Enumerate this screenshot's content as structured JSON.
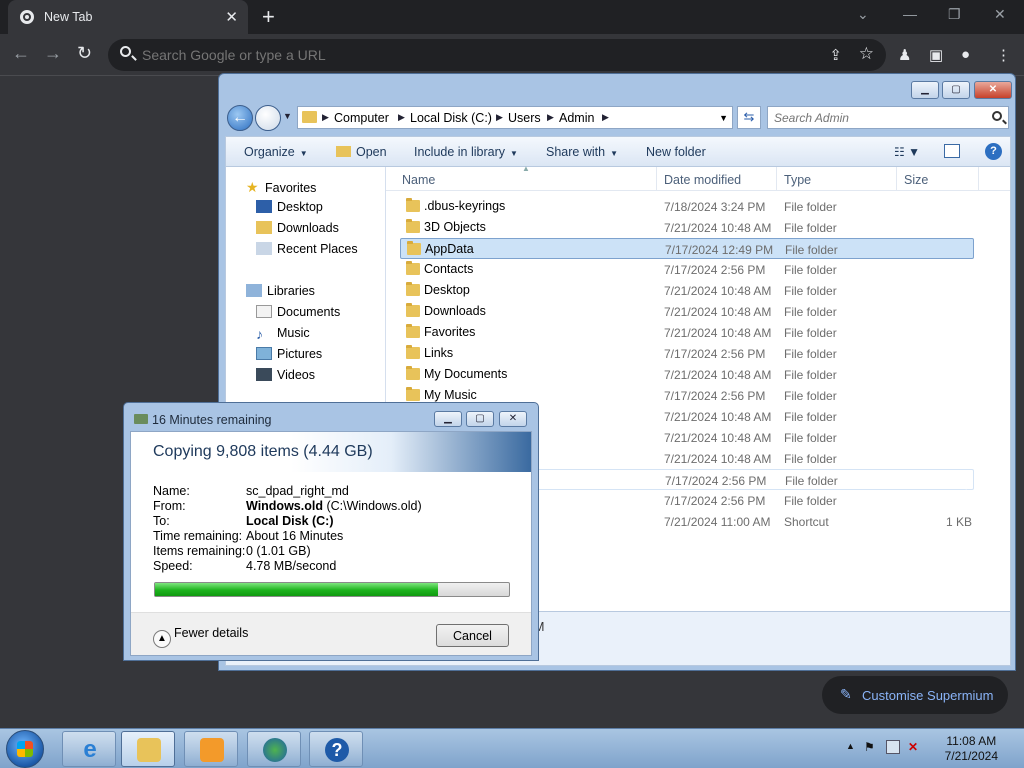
{
  "browser": {
    "tab_title": "New Tab",
    "omnibox_placeholder": "Search Google or type a URL",
    "customise_label": "Customise Supermium"
  },
  "explorer": {
    "breadcrumbs": [
      "Computer",
      "Local Disk (C:)",
      "Users",
      "Admin"
    ],
    "search_placeholder": "Search Admin",
    "commands": {
      "organize": "Organize",
      "open": "Open",
      "include": "Include in library",
      "share": "Share with",
      "new_folder": "New folder"
    },
    "nav": {
      "favorites": "Favorites",
      "desktop": "Desktop",
      "downloads": "Downloads",
      "recent": "Recent Places",
      "libraries": "Libraries",
      "documents": "Documents",
      "music": "Music",
      "pictures": "Pictures",
      "videos": "Videos"
    },
    "columns": {
      "name": "Name",
      "date": "Date modified",
      "type": "Type",
      "size": "Size"
    },
    "files": [
      {
        "name": ".dbus-keyrings",
        "date": "7/18/2024 3:24 PM",
        "type": "File folder",
        "size": ""
      },
      {
        "name": "3D Objects",
        "date": "7/21/2024 10:48 AM",
        "type": "File folder",
        "size": ""
      },
      {
        "name": "AppData",
        "date": "7/17/2024 12:49 PM",
        "type": "File folder",
        "size": ""
      },
      {
        "name": "Contacts",
        "date": "7/17/2024 2:56 PM",
        "type": "File folder",
        "size": ""
      },
      {
        "name": "Desktop",
        "date": "7/21/2024 10:48 AM",
        "type": "File folder",
        "size": ""
      },
      {
        "name": "Downloads",
        "date": "7/21/2024 10:48 AM",
        "type": "File folder",
        "size": ""
      },
      {
        "name": "Favorites",
        "date": "7/21/2024 10:48 AM",
        "type": "File folder",
        "size": ""
      },
      {
        "name": "Links",
        "date": "7/17/2024 2:56 PM",
        "type": "File folder",
        "size": ""
      },
      {
        "name": "My Documents",
        "date": "7/21/2024 10:48 AM",
        "type": "File folder",
        "size": ""
      },
      {
        "name": "My Music",
        "date": "7/17/2024 2:56 PM",
        "type": "File folder",
        "size": ""
      },
      {
        "name": "",
        "date": "7/21/2024 10:48 AM",
        "type": "File folder",
        "size": ""
      },
      {
        "name": "",
        "date": "7/21/2024 10:48 AM",
        "type": "File folder",
        "size": ""
      },
      {
        "name": "",
        "date": "7/21/2024 10:48 AM",
        "type": "File folder",
        "size": ""
      },
      {
        "name": "",
        "date": "7/17/2024 2:56 PM",
        "type": "File folder",
        "size": ""
      },
      {
        "name": "",
        "date": "7/17/2024 2:56 PM",
        "type": "File folder",
        "size": ""
      },
      {
        "name": "",
        "date": "7/21/2024 11:00 AM",
        "type": "Shortcut",
        "size": "1 KB"
      }
    ],
    "selected_index": 2,
    "details_text": "M"
  },
  "copy_dialog": {
    "title": "16 Minutes remaining",
    "heading": "Copying 9,808 items (4.44 GB)",
    "labels": {
      "name": "Name:",
      "from": "From:",
      "to": "To:",
      "time": "Time remaining:",
      "items": "Items remaining:",
      "speed": "Speed:"
    },
    "values": {
      "name": "sc_dpad_right_md",
      "from_bold": "Windows.old",
      "from_rest": " (C:\\Windows.old)",
      "to": "Local Disk (C:)",
      "time": "About 16 Minutes",
      "items": "0 (1.01 GB)",
      "speed": "4.78 MB/second"
    },
    "progress_percent": 80,
    "fewer_details": "Fewer details",
    "cancel": "Cancel"
  },
  "taskbar": {
    "time": "11:08 AM",
    "date": "7/21/2024"
  },
  "colors": {
    "progress_green": "#1db31d",
    "selection": "#cce2f7",
    "chrome_bg": "#35363a"
  }
}
